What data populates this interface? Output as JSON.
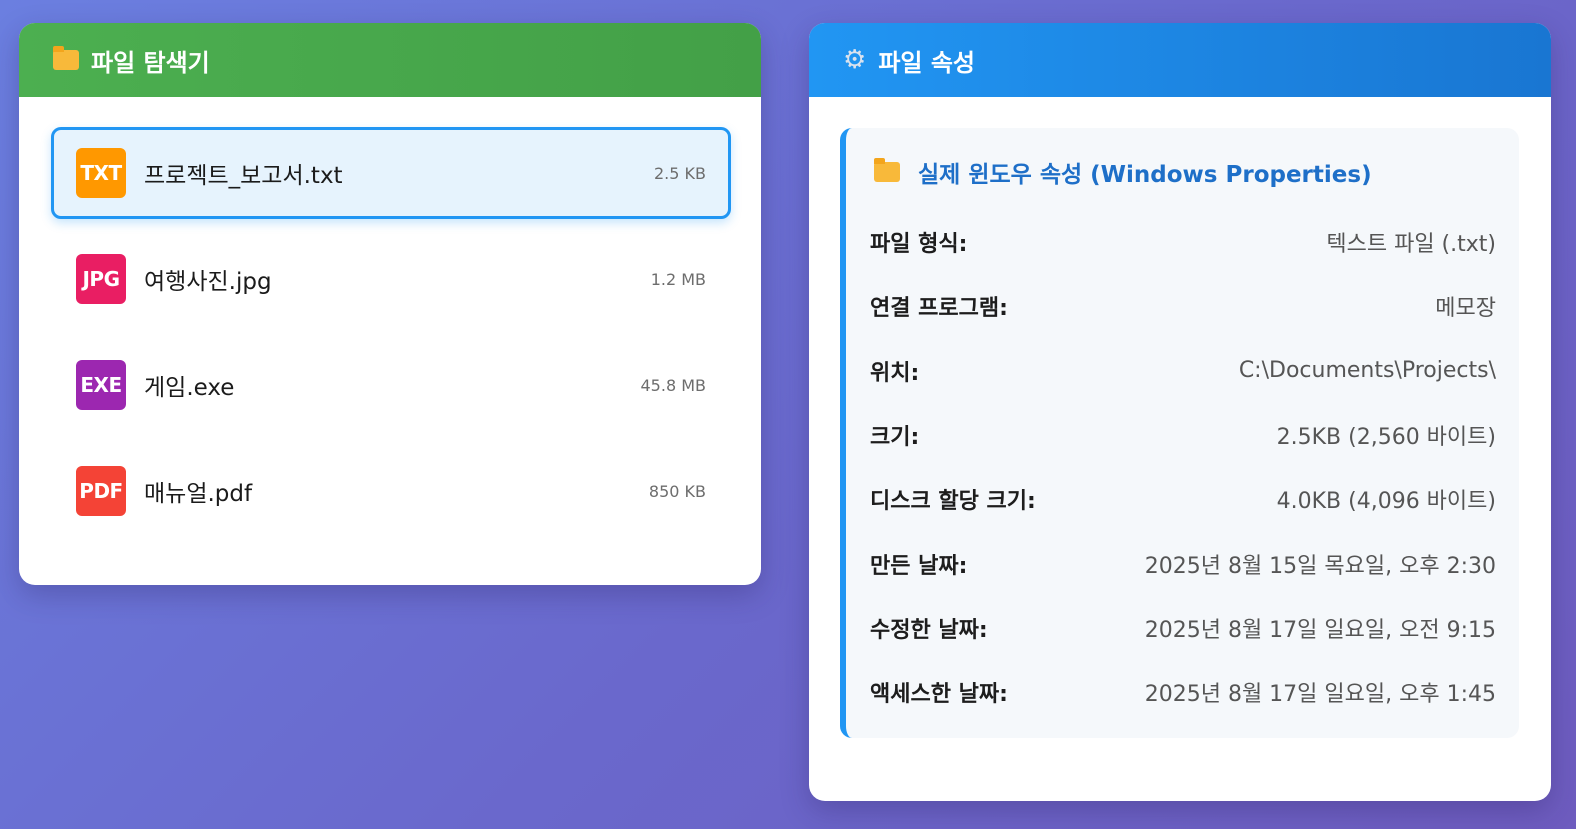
{
  "explorer": {
    "title": "파일 탐색기",
    "files": [
      {
        "badge": "TXT",
        "name": "프로젝트_보고서.txt",
        "size": "2.5 KB",
        "color": "#ff9800",
        "selected": true
      },
      {
        "badge": "JPG",
        "name": "여행사진.jpg",
        "size": "1.2 MB",
        "color": "#e91e63",
        "selected": false
      },
      {
        "badge": "EXE",
        "name": "게임.exe",
        "size": "45.8 MB",
        "color": "#9c27b0",
        "selected": false
      },
      {
        "badge": "PDF",
        "name": "매뉴얼.pdf",
        "size": "850 KB",
        "color": "#f44336",
        "selected": false
      }
    ]
  },
  "properties": {
    "title": "파일 속성",
    "section_title": "실제 윈도우 속성 (Windows Properties)",
    "rows": [
      {
        "label": "파일 형식:",
        "value": "텍스트 파일 (.txt)"
      },
      {
        "label": "연결 프로그램:",
        "value": "메모장"
      },
      {
        "label": "위치:",
        "value": "C:\\Documents\\Projects\\"
      },
      {
        "label": "크기:",
        "value": "2.5KB (2,560 바이트)"
      },
      {
        "label": "디스크 할당 크기:",
        "value": "4.0KB (4,096 바이트)"
      },
      {
        "label": "만든 날짜:",
        "value": "2025년 8월 15일 목요일, 오후 2:30"
      },
      {
        "label": "수정한 날짜:",
        "value": "2025년 8월 17일 일요일, 오전 9:15"
      },
      {
        "label": "액세스한 날짜:",
        "value": "2025년 8월 17일 일요일, 오후 1:45"
      }
    ]
  },
  "icons": {
    "explorer_header": "folder-icon",
    "properties_header": "gear-icon",
    "section": "folder-icon"
  },
  "colors": {
    "explorer_header": "#4caf50",
    "properties_header": "#2196f3",
    "selected_border": "#2196f3",
    "section_title": "#1e6fc8"
  }
}
